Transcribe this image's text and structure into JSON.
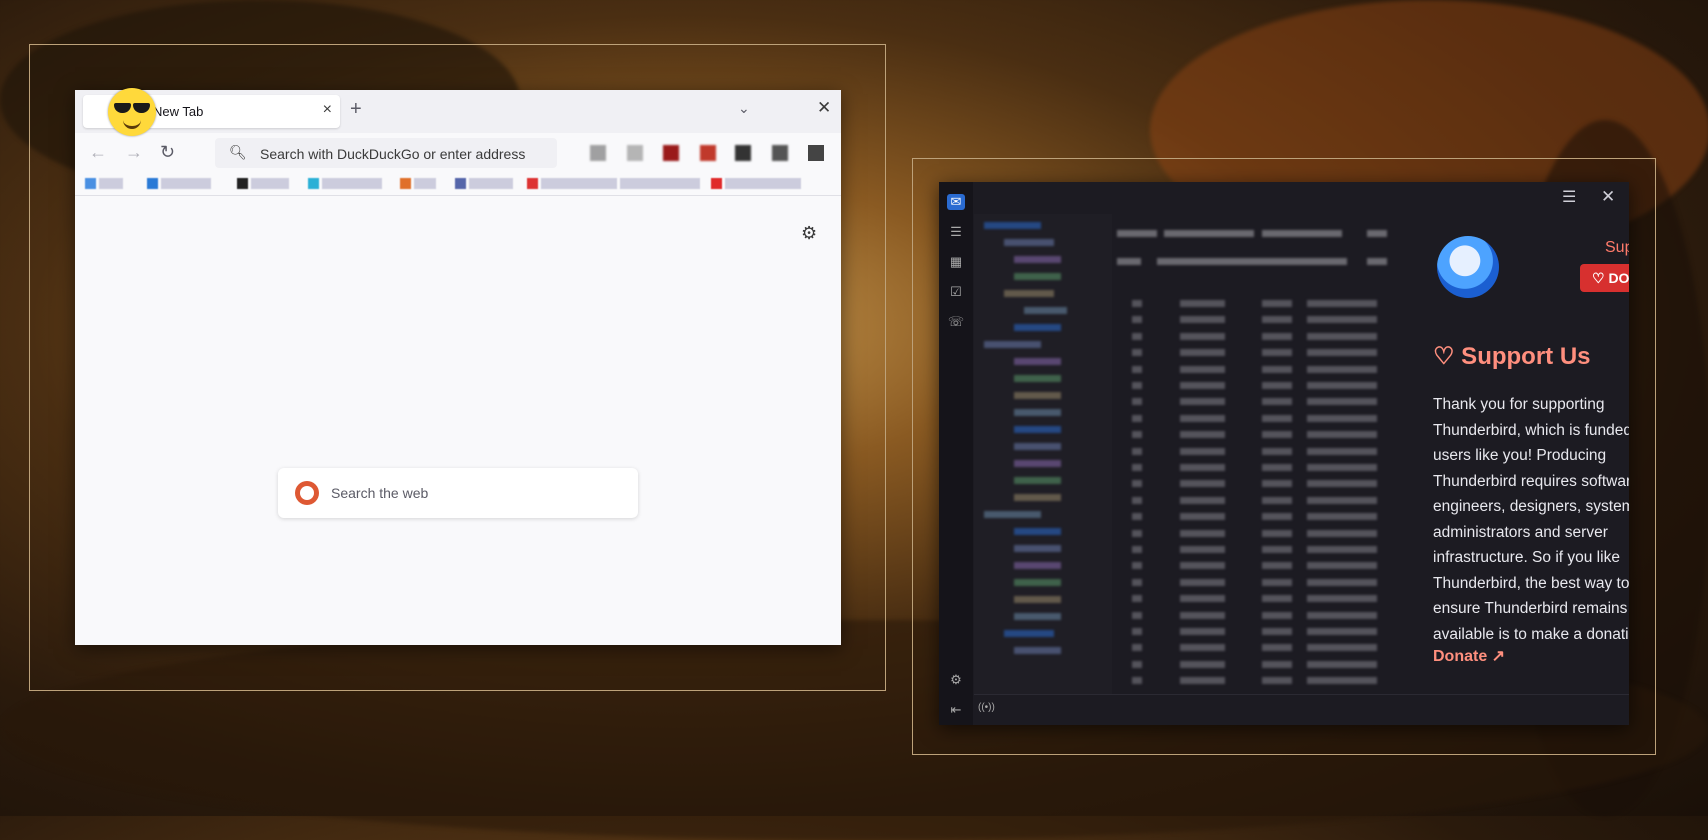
{
  "firefox": {
    "tab_title": "New Tab",
    "tab_close_icon": "×",
    "new_tab_icon": "+",
    "list_tabs_icon": "⌄",
    "window_close_icon": "✕",
    "back_icon": "←",
    "forward_icon": "→",
    "reload_icon": "↻",
    "url_placeholder": "Search with DuckDuckGo or enter address",
    "search_placeholder": "Search the web",
    "settings_icon": "⚙"
  },
  "thunderbird": {
    "menu_icon": "☰",
    "close_icon": "✕",
    "support_small": "Suppor",
    "donate_button": "♡ DONA",
    "support_title": "♡ Support Us",
    "support_body": "Thank you for supporting Thunderbird, which is funded by users like you! Producing Thunderbird requires software engineers, designers, system administrators and server infrastructure. So if you like Thunderbird, the best way to ensure Thunderbird remains available is to make a donation.",
    "donate_link": "Donate ↗",
    "spaces": [
      "mail-icon",
      "address-book-icon",
      "calendar-icon",
      "tasks-icon",
      "chat-icon"
    ],
    "spaces_glyphs": [
      "✉",
      "☰",
      "▦",
      "☑",
      "💬"
    ],
    "settings_icon": "⚙",
    "collapse_icon": "⇤",
    "status_icon": "((•))"
  },
  "colors": {
    "accent_blue": "#2a6bd1",
    "donate_red": "#d7302f",
    "support_coral": "#ff8f7e"
  }
}
